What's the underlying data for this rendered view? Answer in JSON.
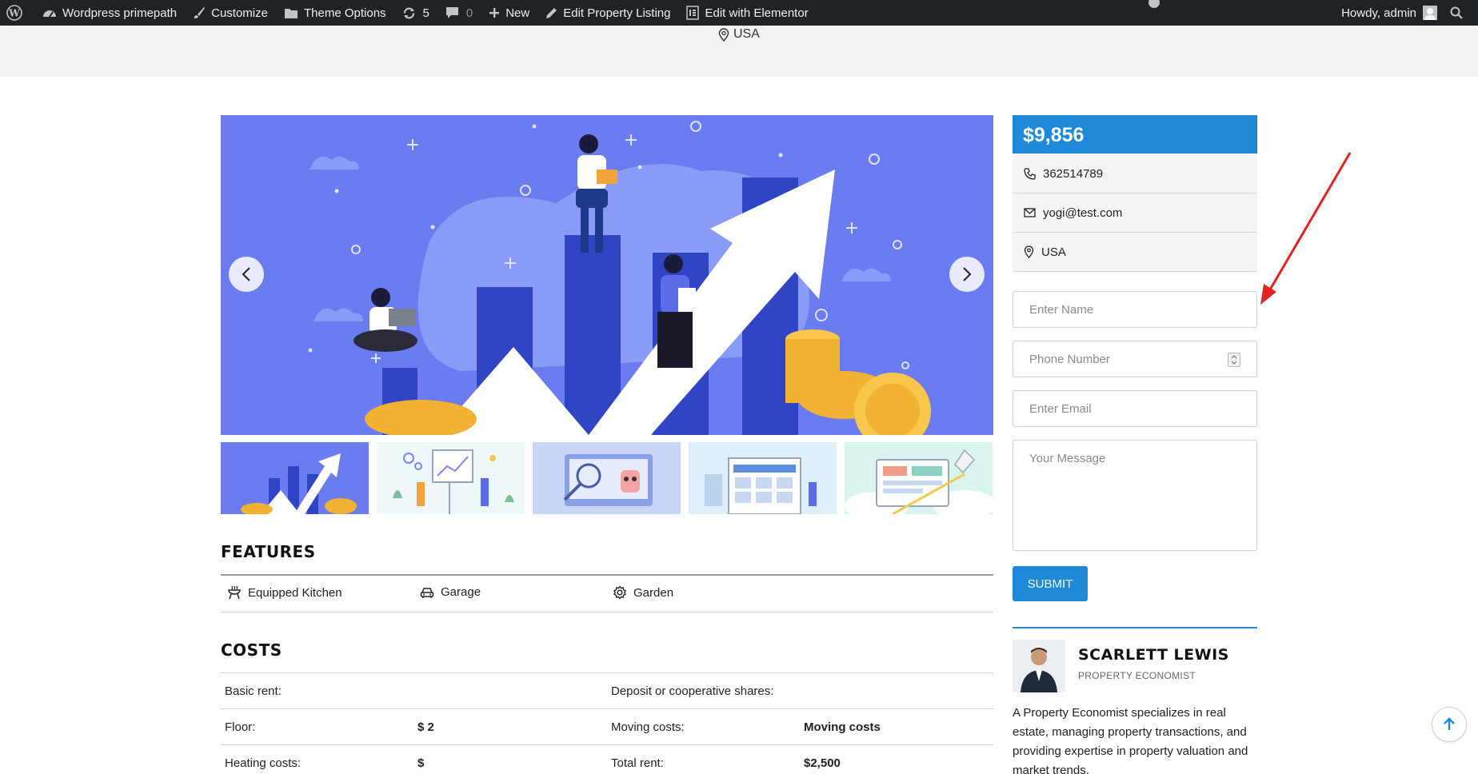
{
  "adminbar": {
    "site_name": "Wordpress primepath",
    "customize": "Customize",
    "theme_options": "Theme Options",
    "updates_count": "5",
    "comments_count": "0",
    "new_label": "New",
    "edit_listing": "Edit Property Listing",
    "edit_elementor": "Edit with Elementor",
    "howdy": "Howdy, admin"
  },
  "top_location": "USA",
  "features": {
    "title": "FEATURES",
    "items": [
      {
        "label": "Equipped Kitchen",
        "icon": "grill-icon"
      },
      {
        "label": "Garage",
        "icon": "car-icon"
      },
      {
        "label": "Garden",
        "icon": "gear-icon"
      }
    ]
  },
  "costs": {
    "title": "COSTS",
    "rows": [
      [
        "Basic rent:",
        "",
        "Deposit or cooperative shares:",
        ""
      ],
      [
        "Floor:",
        "$ 2",
        "Moving costs:",
        "Moving costs"
      ],
      [
        "Heating costs:",
        "$",
        "Total rent:",
        "$2,500"
      ]
    ]
  },
  "sidebar": {
    "price": "$9,856",
    "phone": "362514789",
    "email": "yogi@test.com",
    "location": "USA",
    "form": {
      "name_placeholder": "Enter Name",
      "phone_placeholder": "Phone Number",
      "email_placeholder": "Enter Email",
      "message_placeholder": "Your Message",
      "submit_label": "SUBMIT"
    },
    "agent": {
      "name": "SCARLETT LEWIS",
      "role": "PROPERTY ECONOMIST",
      "bio": "A Property Economist specializes in real estate, managing property transactions, and providing expertise in property valuation and market trends."
    }
  },
  "colors": {
    "accent": "#1e88d9",
    "slider_bg": "#6b7bf0",
    "admin_bar": "#1d2327"
  }
}
